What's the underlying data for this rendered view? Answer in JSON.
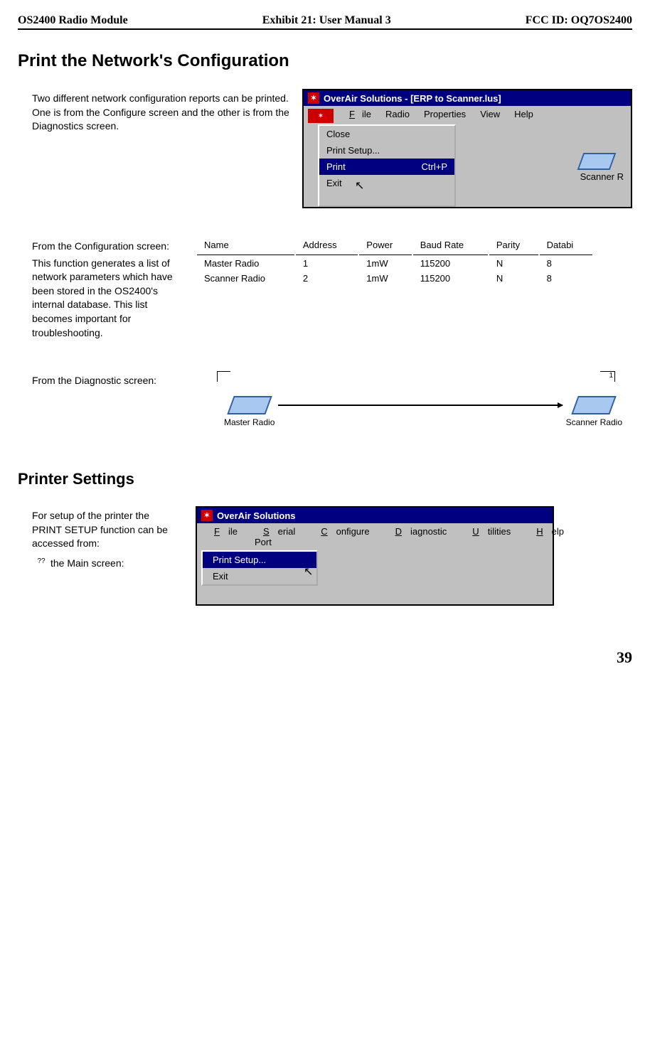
{
  "header": {
    "left": "OS2400 Radio Module",
    "center": "Exhibit 21: User Manual 3",
    "right": "FCC ID: OQ7OS2400"
  },
  "heading1": "Print the Network's Configuration",
  "intro": "Two different network configuration reports can be printed.  One is from the Configure screen and the other is from the Diagnostics screen.",
  "fig1": {
    "title": "OverAir Solutions - [ERP to Scanner.lus]",
    "menus": [
      "File",
      "Radio",
      "Properties",
      "View",
      "Help"
    ],
    "items": [
      {
        "label": "Close",
        "shortcut": ""
      },
      {
        "label": "Print Setup...",
        "shortcut": ""
      },
      {
        "label": "Print",
        "shortcut": "Ctrl+P"
      },
      {
        "label": "Exit",
        "shortcut": ""
      }
    ],
    "side_label": "Scanner R"
  },
  "para2a": "From the Configuration screen:",
  "para2b": "This function generates a list of network parameters which have been stored in the OS2400's internal database.  This list becomes important for troubleshooting.",
  "chart_data": {
    "type": "table",
    "columns": [
      "Name",
      "Address",
      "Power",
      "Baud Rate",
      "Parity",
      "Databi"
    ],
    "rows": [
      [
        "Master Radio",
        "1",
        "1mW",
        "115200",
        "N",
        "8"
      ],
      [
        "Scanner Radio",
        "2",
        "1mW",
        "115200",
        "N",
        "8"
      ]
    ]
  },
  "para3": "From the Diagnostic screen:",
  "diagram": {
    "left": "Master Radio",
    "right": "Scanner Radio",
    "corner": "1"
  },
  "heading2": "Printer Settings",
  "para4": "For setup of the printer the PRINT SETUP function can be accessed from:",
  "bullet": {
    "marker": "??",
    "text": "the Main screen:"
  },
  "fig4": {
    "title": "OverAir Solutions",
    "menus": [
      "File",
      "Serial Port",
      "Configure",
      "Diagnostic",
      "Utilities",
      "Help"
    ],
    "items": [
      {
        "label": "Print Setup..."
      },
      {
        "label": "Exit"
      }
    ]
  },
  "page_number": "39"
}
